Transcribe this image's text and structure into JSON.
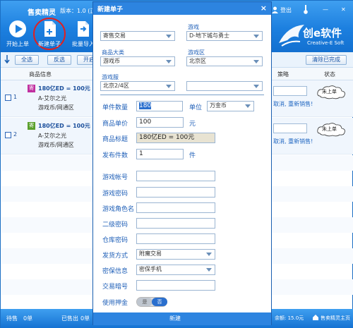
{
  "main": {
    "title": "售卖精灵",
    "version": "版本：1.0 (正",
    "toolbar": [
      {
        "label": "开始上单",
        "icon": "play-icon"
      },
      {
        "label": "新建单子",
        "icon": "new-document-icon"
      },
      {
        "label": "批量导入",
        "icon": "batch-import-icon"
      }
    ],
    "top_right": {
      "user_icon": "user-icon",
      "logout": "登出",
      "temp_icon": "thermometer-icon",
      "minimize": "—",
      "close": "✕"
    },
    "logo": {
      "text": "创e软件",
      "sub": "Creative-E Soft",
      "icon": "bird-logo-icon"
    },
    "filter": {
      "select_all": "全选",
      "invert": "反选",
      "start": "开启",
      "clear_complete": "清除已完成"
    },
    "columns": {
      "product": "商品信息",
      "strategy": "策略",
      "status": "状态"
    },
    "rows": [
      {
        "num": "1",
        "badge": "寄",
        "badge_color": "#c030a0",
        "price": "180亿ED = 100元",
        "server": "A-艾尔之光",
        "service": "游戏币/网通区",
        "cancel": "取消, 重新销售!",
        "status": "未上单"
      },
      {
        "num": "2",
        "badge": "寄",
        "badge_color": "#5aa02c",
        "price": "180亿ED = 100元",
        "server": "A-艾尔之光",
        "service": "游戏币/网通区",
        "cancel": "取消, 重新销售!",
        "status": "未上单"
      }
    ],
    "bottom": {
      "pending_label": "待售",
      "pending_value": "0单",
      "sold_label": "已售出",
      "sold_value": "0单",
      "balance": "余额: 15.0元",
      "home_link": "售卖精灵主页"
    },
    "colors": {
      "header_blue": "#1c7fdf",
      "link_blue": "#2268c2"
    }
  },
  "dialog": {
    "title": "新建单子",
    "close": "×",
    "trade_type": {
      "value": "寄售交易"
    },
    "game": {
      "label": "游戏",
      "value": "D-地下城与勇士"
    },
    "category": {
      "label": "商品大类",
      "value": "游戏币"
    },
    "region": {
      "label": "游戏区",
      "value": "北京区"
    },
    "server": {
      "label": "游戏服",
      "value": "北京2/4区",
      "extra_value": ""
    },
    "form": {
      "quantity": {
        "label": "单件数量",
        "value": "180",
        "unit_label": "单位",
        "unit_value": "万金币"
      },
      "price": {
        "label": "商品单价",
        "value": "100",
        "unit": "元"
      },
      "product_title": {
        "label": "商品标题",
        "value": "180亿ED = 100元"
      },
      "publish_count": {
        "label": "发布件数",
        "value": "1",
        "unit": "件"
      },
      "account": {
        "label": "游戏帐号",
        "value": ""
      },
      "password": {
        "label": "游戏密码",
        "value": ""
      },
      "role_name": {
        "label": "游戏角色名",
        "value": ""
      },
      "second_pwd": {
        "label": "二级密码",
        "value": ""
      },
      "warehouse_pwd": {
        "label": "仓库密码",
        "value": ""
      },
      "delivery": {
        "label": "发货方式",
        "value": "附魔交易"
      },
      "security": {
        "label": "密保信息",
        "value": "密保手机"
      },
      "trade_code": {
        "label": "交易暗号",
        "value": ""
      },
      "deposit": {
        "label": "使用押金",
        "yes": "是",
        "no": "否"
      }
    },
    "create_button": "新建"
  }
}
